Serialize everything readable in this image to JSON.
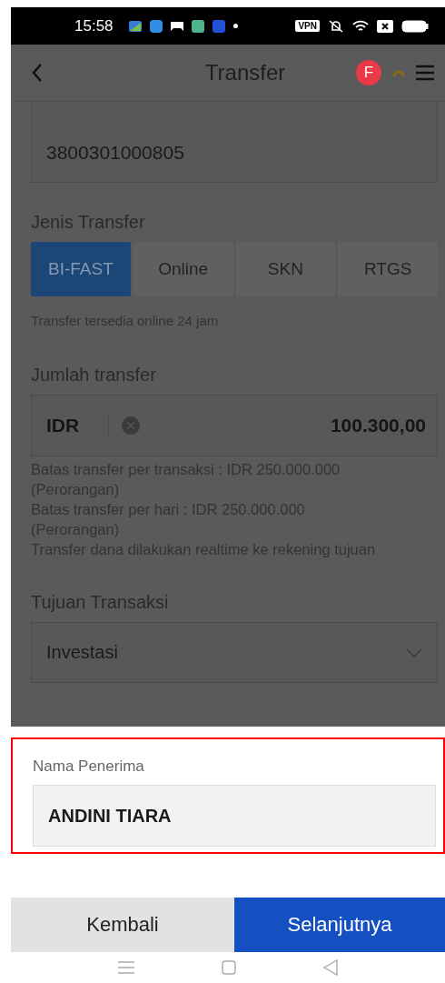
{
  "status_bar": {
    "time": "15:58",
    "vpn": "VPN"
  },
  "header": {
    "title": "Transfer",
    "badge": "F"
  },
  "form": {
    "dimmed": true,
    "account_field": {
      "value": "3800301000805"
    },
    "transfer_type": {
      "label": "Jenis Transfer",
      "options": [
        {
          "label": "BI-FAST",
          "selected": true
        },
        {
          "label": "Online",
          "selected": false
        },
        {
          "label": "SKN",
          "selected": false
        },
        {
          "label": "RTGS",
          "selected": false
        }
      ],
      "note": "Transfer tersedia online 24 jam"
    },
    "amount": {
      "label": "Jumlah transfer",
      "currency": "IDR",
      "value": "100.300,00",
      "notes": [
        "Batas transfer per transaksi : IDR 250.000.000 (Perorangan)",
        "Batas transfer per hari : IDR 250.000.000 (Perorangan)",
        "Transfer dana dilakukan realtime ke rekening tujuan"
      ]
    },
    "purpose": {
      "label": "Tujuan Transaksi",
      "value": "Investasi"
    }
  },
  "recipient": {
    "highlighted": true,
    "label": "Nama Penerima",
    "value": "ANDINI TIARA"
  },
  "buttons": [
    {
      "label": "Kembali",
      "kind": "secondary"
    },
    {
      "label": "Selanjutnya",
      "kind": "primary"
    }
  ]
}
